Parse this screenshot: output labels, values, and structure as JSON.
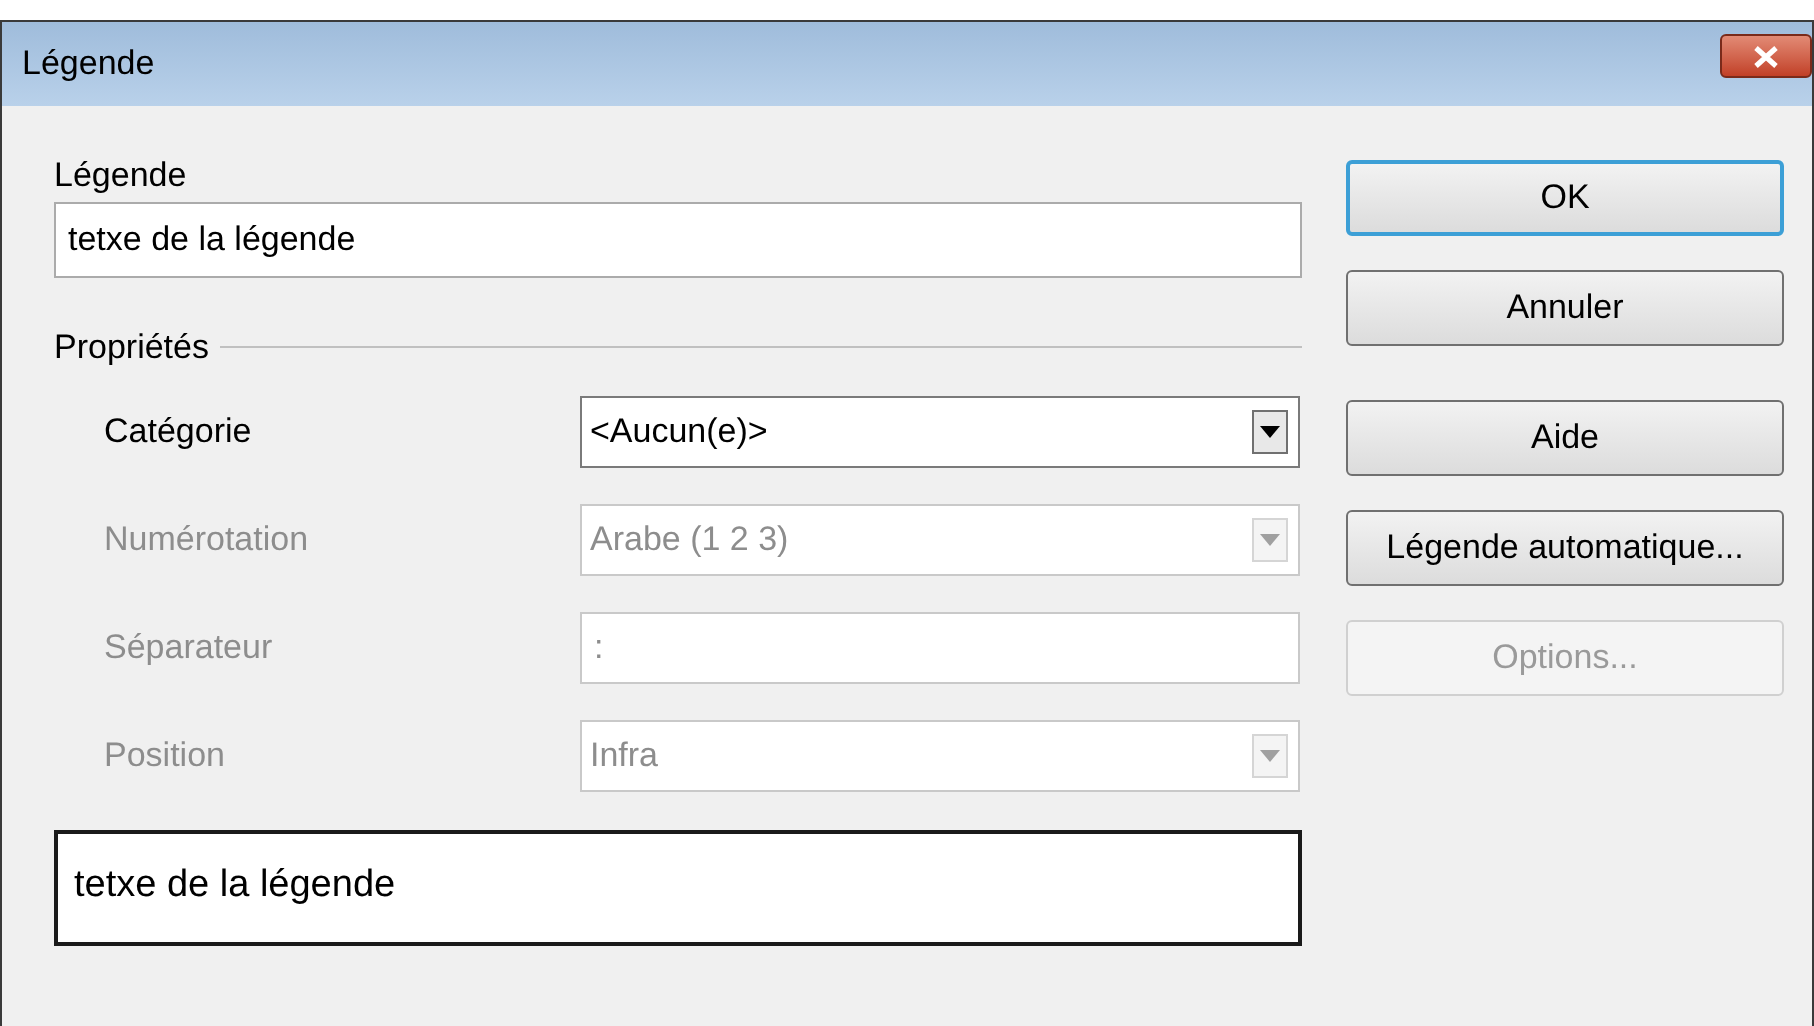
{
  "window": {
    "title": "Légende"
  },
  "caption": {
    "label": "Légende",
    "value": "tetxe de la légende"
  },
  "properties": {
    "title": "Propriétés",
    "fields": [
      {
        "kind": "dropdown",
        "label": "Catégorie",
        "value": "<Aucun(e)>",
        "disabled": false
      },
      {
        "kind": "dropdown",
        "label": "Numérotation",
        "value": "Arabe (1 2 3)",
        "disabled": true
      },
      {
        "kind": "text",
        "label": "Séparateur",
        "value": ":",
        "disabled": true
      },
      {
        "kind": "dropdown",
        "label": "Position",
        "value": "Infra",
        "disabled": true
      }
    ]
  },
  "preview": {
    "text": "tetxe de la légende"
  },
  "buttons": [
    {
      "label": "OK",
      "default": true,
      "disabled": false
    },
    {
      "label": "Annuler",
      "default": false,
      "disabled": false
    },
    {
      "label": "Aide",
      "default": false,
      "disabled": false
    },
    {
      "label": "Légende automatique...",
      "default": false,
      "disabled": false
    },
    {
      "label": "Options...",
      "default": false,
      "disabled": true
    }
  ]
}
